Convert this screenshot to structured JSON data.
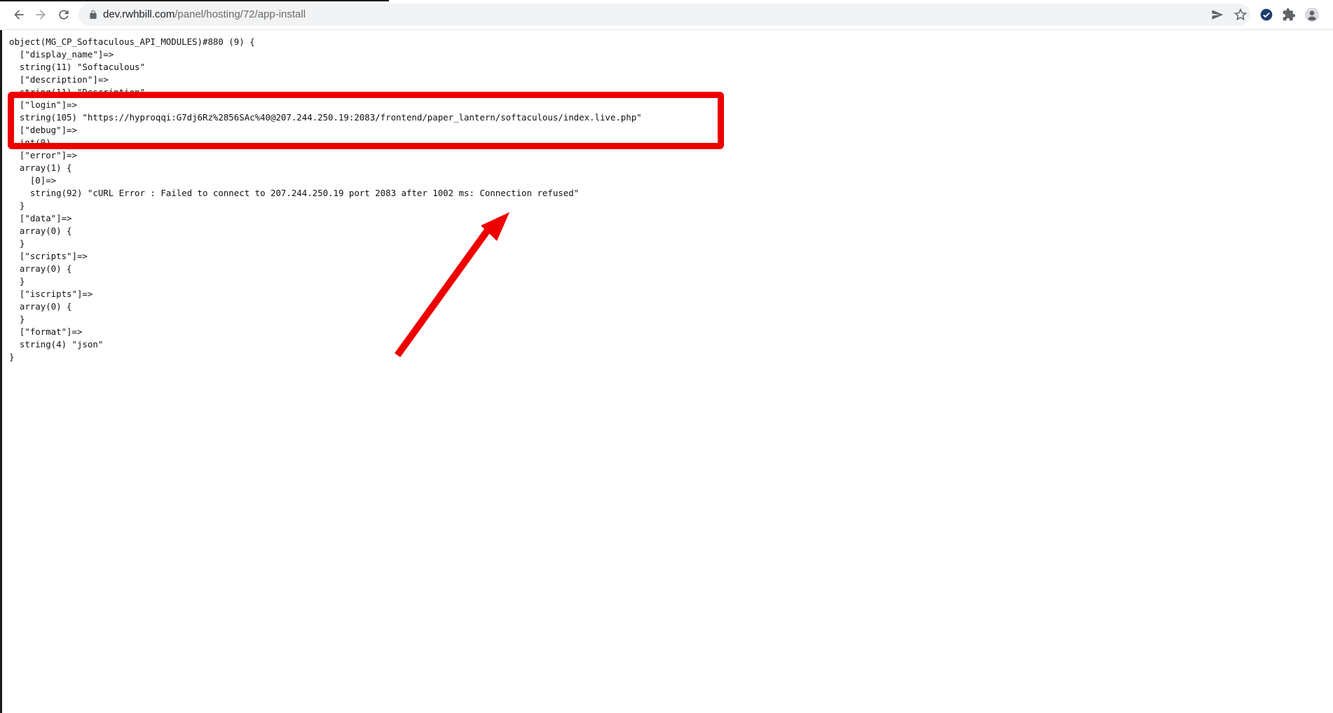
{
  "browser": {
    "url_host": "dev.rwhbill.com",
    "url_path": "/panel/hosting/72/app-install",
    "icons": {
      "back": "arrow-left-icon",
      "forward": "arrow-right-icon",
      "reload": "reload-icon",
      "lock": "lock-icon",
      "send": "send-icon",
      "bookmark": "star-icon",
      "extension_check": "check-circle-icon",
      "extensions": "puzzle-icon",
      "profile": "avatar-icon"
    }
  },
  "dump": {
    "lines": [
      "object(MG_CP_Softaculous_API_MODULES)#880 (9) {",
      "  [\"display_name\"]=>",
      "  string(11) \"Softaculous\"",
      "  [\"description\"]=>",
      "  string(11) \"Description\"",
      "  [\"login\"]=>",
      "  string(105) \"https://hyproqqi:G7dj6Rz%2856SAc%40@207.244.250.19:2083/frontend/paper_lantern/softaculous/index.live.php\"",
      "  [\"debug\"]=>",
      "  int(0)",
      "  [\"error\"]=>",
      "  array(1) {",
      "    [0]=>",
      "    string(92) \"cURL Error : Failed to connect to 207.244.250.19 port 2083 after 1002 ms: Connection refused\"",
      "  }",
      "  [\"data\"]=>",
      "  array(0) {",
      "  }",
      "  [\"scripts\"]=>",
      "  array(0) {",
      "  }",
      "  [\"iscripts\"]=>",
      "  array(0) {",
      "  }",
      "  [\"format\"]=>",
      "  string(4) \"json\"",
      "}"
    ]
  },
  "annotations": {
    "color": "#ee0000"
  }
}
